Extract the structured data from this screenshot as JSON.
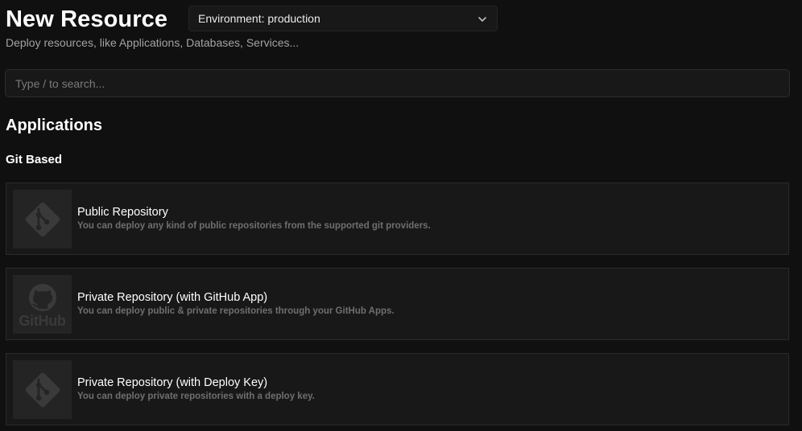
{
  "header": {
    "title": "New Resource",
    "subtitle": "Deploy resources, like Applications, Databases, Services..."
  },
  "environment": {
    "value": "Environment: production"
  },
  "search": {
    "placeholder": "Type / to search..."
  },
  "sections": {
    "applications": {
      "title": "Applications",
      "git_based": {
        "title": "Git Based",
        "items": [
          {
            "title": "Public Repository",
            "description": "You can deploy any kind of public repositories from the supported git providers.",
            "icon": "git-icon"
          },
          {
            "title": "Private Repository (with GitHub App)",
            "description": "You can deploy public & private repositories through your GitHub Apps.",
            "icon": "github-icon",
            "icon_text": "GitHub"
          },
          {
            "title": "Private Repository (with Deploy Key)",
            "description": "You can deploy private repositories with a deploy key.",
            "icon": "git-icon"
          }
        ]
      }
    }
  },
  "colors": {
    "background": "#101010",
    "card": "#181818",
    "logo_tile": "#242424",
    "icon": "#3a3a3a"
  }
}
